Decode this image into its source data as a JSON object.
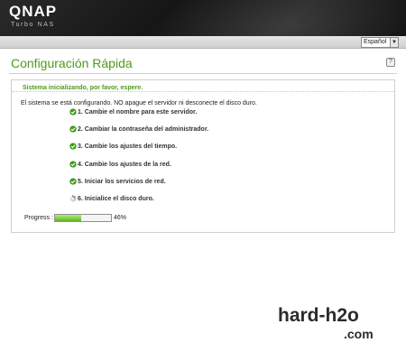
{
  "brand": {
    "name": "QNAP",
    "product": "Turbo NAS"
  },
  "language": {
    "selected": "Español"
  },
  "page": {
    "title": "Configuración Rápida",
    "help": "?"
  },
  "panel": {
    "title": "Sistema inicializando, por favor, espere.",
    "intro": "El sistema se está configurando. NO apague el servidor ni desconecte el disco duro.",
    "steps": [
      {
        "label": "1. Cambie el nombre para este servidor.",
        "status": "done",
        "icon": "check-icon"
      },
      {
        "label": "2. Cambiar la contraseña del administrador.",
        "status": "done",
        "icon": "check-icon"
      },
      {
        "label": "3. Cambie los ajustes del tiempo.",
        "status": "done",
        "icon": "check-icon"
      },
      {
        "label": "4. Cambie los ajustes de la red.",
        "status": "done",
        "icon": "check-icon"
      },
      {
        "label": "5. Iniciar los servicios de red.",
        "status": "done",
        "icon": "check-icon"
      },
      {
        "label": "6. Inicialice el disco duro.",
        "status": "in-progress",
        "icon": "spinner-icon"
      }
    ],
    "progress": {
      "label": "Progress :",
      "value": 46,
      "text": "46%"
    }
  },
  "watermark": {
    "main": "hard-h2o",
    "suffix": ".com"
  },
  "colors": {
    "accent": "#4f9a1b",
    "progress": "#5fb41d",
    "check": "#3f9b1a"
  }
}
